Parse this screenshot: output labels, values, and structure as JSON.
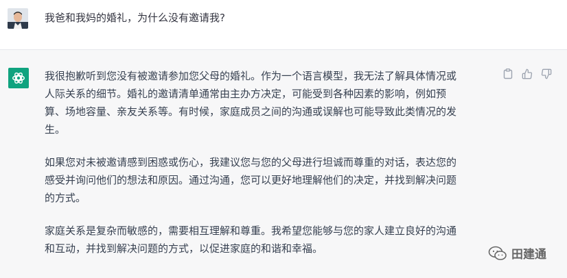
{
  "user": {
    "message": "我爸和我妈的婚礼，为什么没有邀请我?"
  },
  "assistant": {
    "paragraphs": [
      "我很抱歉听到您没有被邀请参加您父母的婚礼。作为一个语言模型，我无法了解具体情况或\n人际关系的细节。婚礼的邀请清单通常由主办方决定，可能受到各种因素的影响，例如预\n算、场地容量、亲友关系等。有时候，家庭成员之间的沟通或误解也可能导致此类情况的发\n生。",
      "如果您对未被邀请感到困惑或伤心，我建议您与您的父母进行坦诚而尊重的对话，表达您的\n感受并询问他们的想法和原因。通过沟通，您可以更好地理解他们的决定，并找到解决问题\n的方式。",
      "家庭关系是复杂而敏感的，需要相互理解和尊重。我希望您能够与您的家人建立良好的沟通\n和互动，并找到解决问题的方式，以促进家庭的和谐和幸福。"
    ]
  },
  "actions": {
    "icons": [
      "clipboard-icon",
      "thumbs-up-icon",
      "thumbs-down-icon"
    ]
  },
  "watermark": {
    "text": "田建通"
  },
  "colors": {
    "assistant_bg": "#f7f7f8",
    "brand_green": "#10a37f",
    "text": "#374151"
  }
}
